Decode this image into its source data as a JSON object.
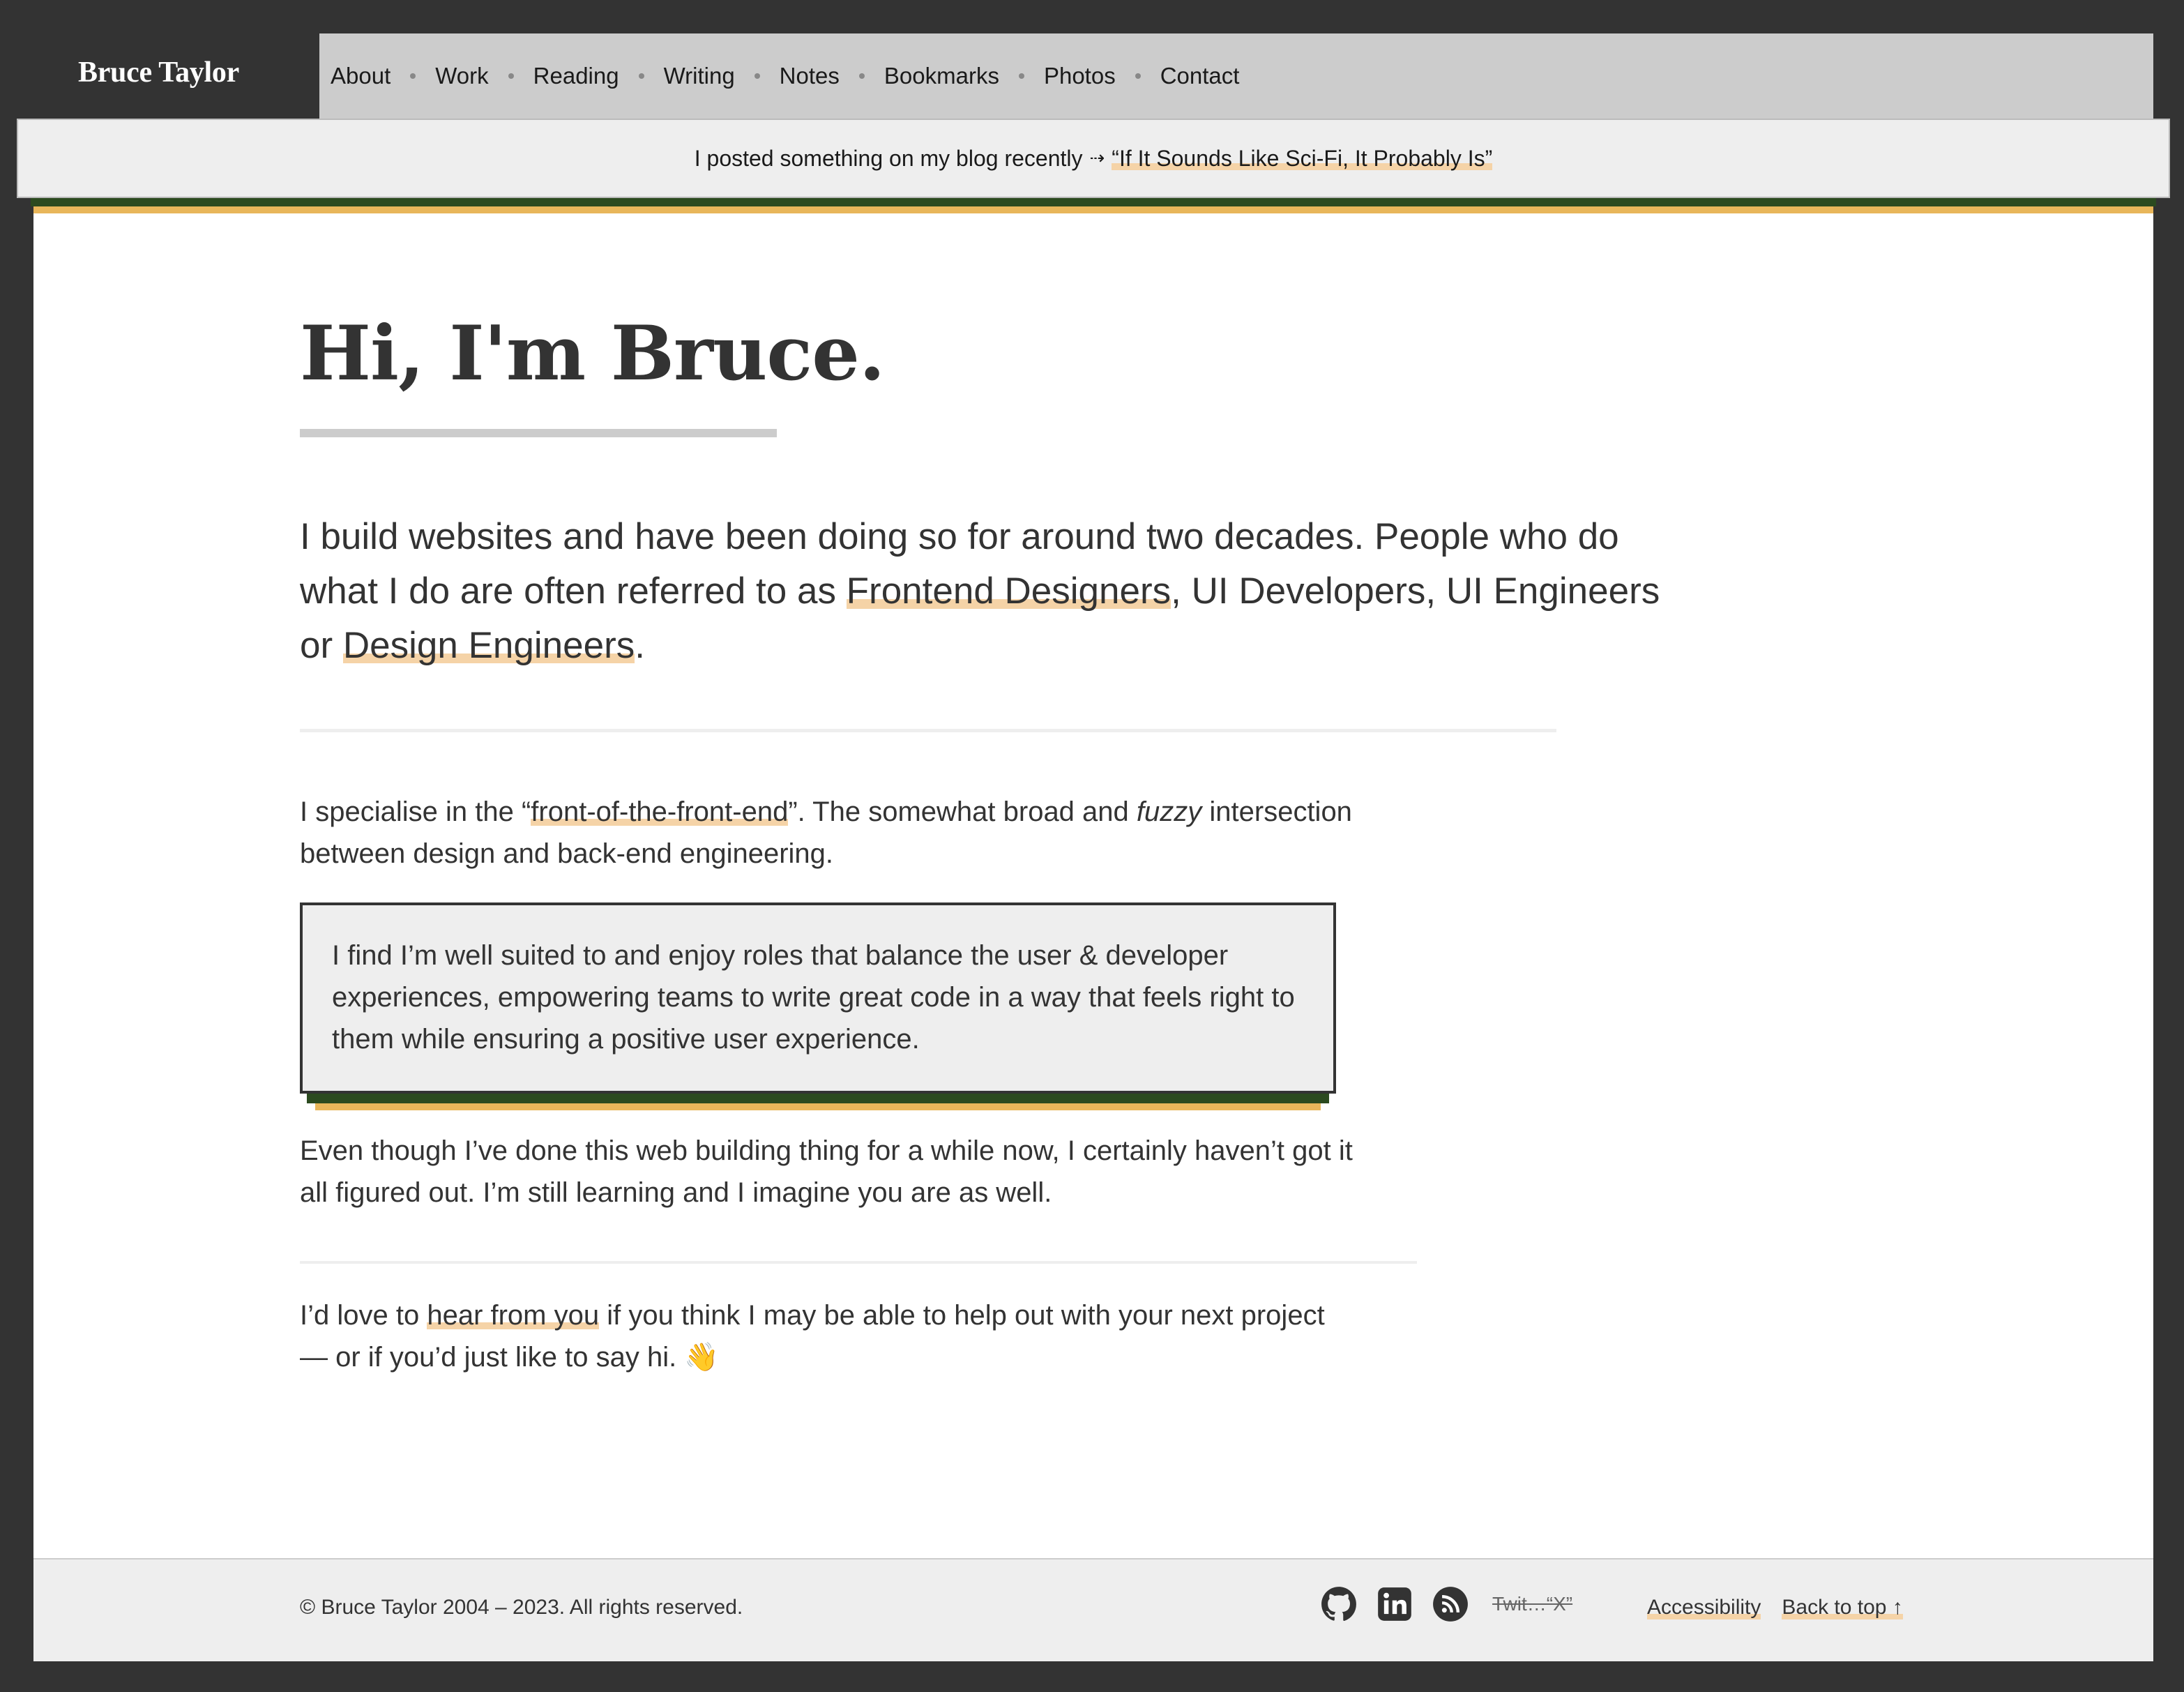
{
  "header": {
    "brand": "Bruce Taylor",
    "nav": [
      {
        "label": "About"
      },
      {
        "label": "Work"
      },
      {
        "label": "Reading"
      },
      {
        "label": "Writing"
      },
      {
        "label": "Notes"
      },
      {
        "label": "Bookmarks"
      },
      {
        "label": "Photos"
      },
      {
        "label": "Contact"
      }
    ]
  },
  "announcement": {
    "text": "I posted something on my blog recently",
    "arrow": "⇢",
    "link": "“If It Sounds Like Sci-Fi, It Probably Is”"
  },
  "main": {
    "title": "Hi, I'm Bruce.",
    "lead": {
      "part1": "I build websites and have been doing so for around two decades. People who do what I do are often referred to as ",
      "link1": "Frontend Designers",
      "part2": ", UI Developers, UI Engineers or ",
      "link2": "Design Engineers",
      "part3": "."
    },
    "p1": {
      "part1": "I specialise in the “",
      "link": "front-of-the-front-end",
      "part2": "”. The somewhat broad and ",
      "em": "fuzzy",
      "part3": " intersection between design and back-end engineering."
    },
    "callout": "I find I’m well suited to and enjoy roles that balance the user & developer experiences, empowering teams to write great code in a way that feels right to them while ensuring a positive user experience.",
    "p2": "Even though I’ve done this web building thing for a while now, I certainly haven’t got it all figured out. I’m still learning and I imagine you are as well.",
    "p3": {
      "part1": "I’d love to ",
      "link": "hear from you",
      "part2": " if you think I may be able to help out with your next project — or if you’d just like to say hi. ",
      "emoji": "👋"
    }
  },
  "footer": {
    "copyright": "© Bruce Taylor 2004 – 2023. All rights reserved.",
    "social": [
      {
        "icon": "github-icon"
      },
      {
        "icon": "linkedin-icon"
      },
      {
        "icon": "rss-icon"
      }
    ],
    "twitter": "Twit…“X”",
    "links": {
      "accessibility": "Accessibility",
      "back_to_top": "Back to top ↑"
    }
  },
  "colors": {
    "frame": "#333333",
    "nav_bg": "#cccccc",
    "panel_bg": "#eeeeee",
    "highlight": "#f5d3a7",
    "accent_green": "#2b4a1f",
    "accent_gold": "#e8b65a"
  }
}
